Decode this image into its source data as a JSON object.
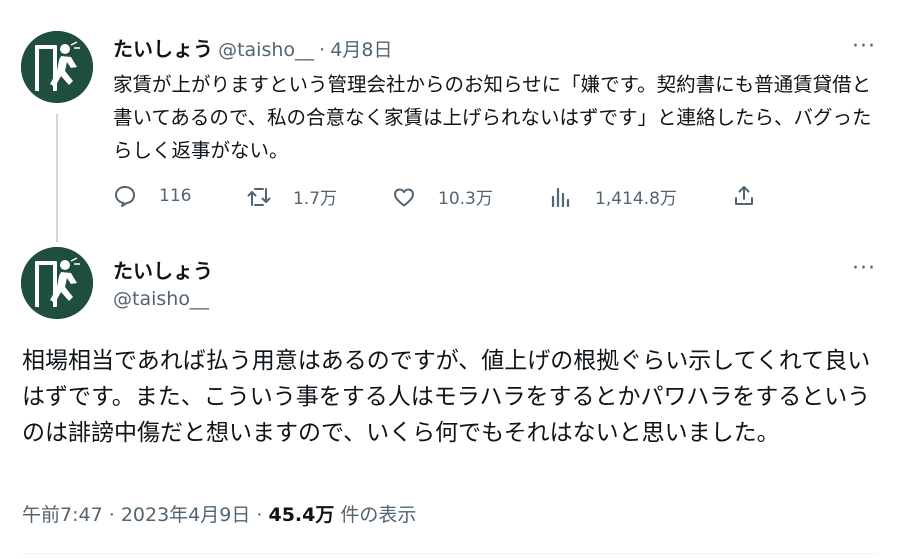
{
  "tweet1": {
    "display_name": "たいしょう",
    "handle": "@taisho__",
    "separator": "·",
    "date": "4月8日",
    "more_label": "···",
    "text": "家賃が上がりますという管理会社からのお知らせに「嫌です。契約書にも普通賃貸借と書いてあるので、私の合意なく家賃は上げられないはずです」と連絡したら、バグったらしく返事がない。",
    "actions": {
      "replies": "116",
      "retweets": "1.7万",
      "likes": "10.3万",
      "views": "1,414.8万"
    }
  },
  "tweet2": {
    "display_name": "たいしょう",
    "handle": "@taisho__",
    "more_label": "···",
    "text": "相場相当であれば払う用意はあるのですが、値上げの根拠ぐらい示してくれて良いはずです。また、こういう事をする人はモラハラをするとかパワハラをするというのは誹謗中傷だと想いますので、いくら何でもそれはないと思いました。",
    "time": "午前7:47",
    "meta_sep": "·",
    "date": "2023年4月9日",
    "views_count": "45.4万",
    "views_label": "件の表示"
  },
  "colors": {
    "text": "#0f1419",
    "secondary": "#536471",
    "avatar_bg": "#1f4d3e",
    "thread_line": "#cfd9de"
  }
}
